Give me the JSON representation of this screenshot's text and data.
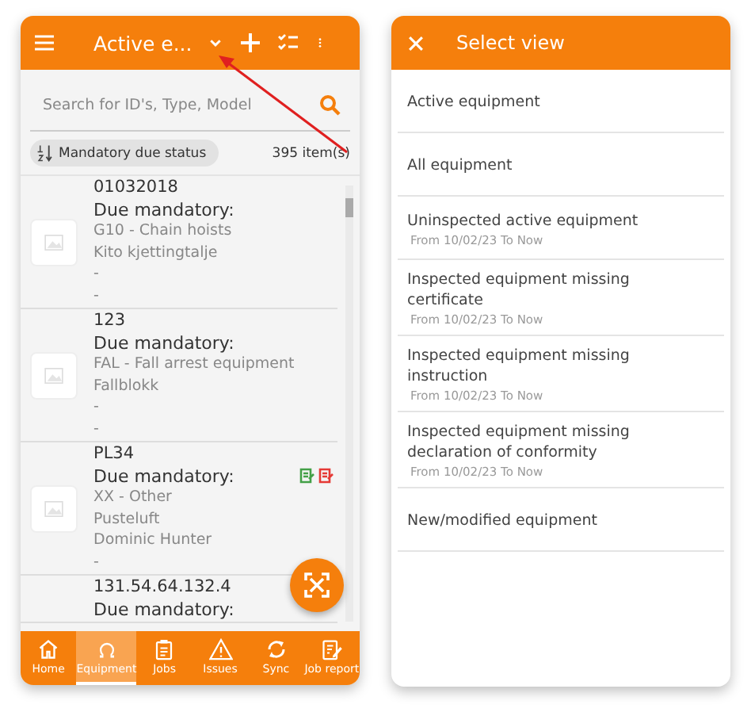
{
  "main_screen": {
    "header": {
      "title": "Active e..."
    },
    "search": {
      "placeholder": "Search for ID's, Type, Model"
    },
    "sort": {
      "label": "Mandatory due status"
    },
    "count": "395 item(s)",
    "items": [
      {
        "id": "01032018",
        "due": "Due mandatory:",
        "lines": [
          "G10 - Chain hoists",
          "Kito kjettingtalje",
          "-",
          "-"
        ]
      },
      {
        "id": "123",
        "due": "Due mandatory:",
        "lines": [
          "FAL - Fall arrest equipment",
          "Fallblokk",
          "-",
          "-"
        ]
      },
      {
        "id": "PL34",
        "due": "Due mandatory:",
        "lines": [
          "XX - Other",
          "Pusteluft",
          "Dominic Hunter",
          "-"
        ],
        "badges": [
          {
            "color": "#43a047"
          },
          {
            "color": "#e53935"
          }
        ]
      },
      {
        "id": "131.54.64.132.4",
        "due": "Due mandatory:"
      }
    ],
    "nav": [
      {
        "label": "Home",
        "kind": "home",
        "selected": false
      },
      {
        "label": "Equipment",
        "kind": "equipment",
        "selected": true
      },
      {
        "label": "Jobs",
        "kind": "jobs",
        "selected": false
      },
      {
        "label": "Issues",
        "kind": "issues",
        "selected": false
      },
      {
        "label": "Sync",
        "kind": "sync",
        "selected": false
      },
      {
        "label": "Job report",
        "kind": "report",
        "selected": false
      }
    ]
  },
  "select_view": {
    "title": "Select view",
    "views": [
      {
        "label": "Active equipment"
      },
      {
        "label": "All equipment"
      },
      {
        "label": "Uninspected active equipment",
        "subtitle": "From 10/02/23 To Now"
      },
      {
        "label": "Inspected equipment missing certificate",
        "subtitle": "From 10/02/23 To Now"
      },
      {
        "label": "Inspected equipment missing instruction",
        "subtitle": "From 10/02/23 To Now"
      },
      {
        "label": "Inspected equipment missing declaration of conformity",
        "subtitle": "From 10/02/23 To Now"
      },
      {
        "label": "New/modified equipment"
      }
    ]
  }
}
